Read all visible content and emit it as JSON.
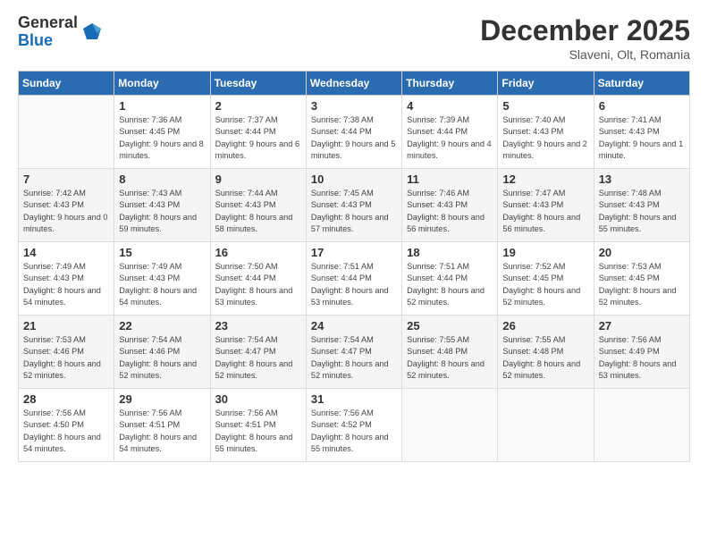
{
  "header": {
    "logo_general": "General",
    "logo_blue": "Blue",
    "month_title": "December 2025",
    "location": "Slaveni, Olt, Romania"
  },
  "weekdays": [
    "Sunday",
    "Monday",
    "Tuesday",
    "Wednesday",
    "Thursday",
    "Friday",
    "Saturday"
  ],
  "weeks": [
    [
      {
        "day": "",
        "sunrise": "",
        "sunset": "",
        "daylight": ""
      },
      {
        "day": "1",
        "sunrise": "7:36 AM",
        "sunset": "4:45 PM",
        "daylight": "9 hours and 8 minutes."
      },
      {
        "day": "2",
        "sunrise": "7:37 AM",
        "sunset": "4:44 PM",
        "daylight": "9 hours and 6 minutes."
      },
      {
        "day": "3",
        "sunrise": "7:38 AM",
        "sunset": "4:44 PM",
        "daylight": "9 hours and 5 minutes."
      },
      {
        "day": "4",
        "sunrise": "7:39 AM",
        "sunset": "4:44 PM",
        "daylight": "9 hours and 4 minutes."
      },
      {
        "day": "5",
        "sunrise": "7:40 AM",
        "sunset": "4:43 PM",
        "daylight": "9 hours and 2 minutes."
      },
      {
        "day": "6",
        "sunrise": "7:41 AM",
        "sunset": "4:43 PM",
        "daylight": "9 hours and 1 minute."
      }
    ],
    [
      {
        "day": "7",
        "sunrise": "7:42 AM",
        "sunset": "4:43 PM",
        "daylight": "9 hours and 0 minutes."
      },
      {
        "day": "8",
        "sunrise": "7:43 AM",
        "sunset": "4:43 PM",
        "daylight": "8 hours and 59 minutes."
      },
      {
        "day": "9",
        "sunrise": "7:44 AM",
        "sunset": "4:43 PM",
        "daylight": "8 hours and 58 minutes."
      },
      {
        "day": "10",
        "sunrise": "7:45 AM",
        "sunset": "4:43 PM",
        "daylight": "8 hours and 57 minutes."
      },
      {
        "day": "11",
        "sunrise": "7:46 AM",
        "sunset": "4:43 PM",
        "daylight": "8 hours and 56 minutes."
      },
      {
        "day": "12",
        "sunrise": "7:47 AM",
        "sunset": "4:43 PM",
        "daylight": "8 hours and 56 minutes."
      },
      {
        "day": "13",
        "sunrise": "7:48 AM",
        "sunset": "4:43 PM",
        "daylight": "8 hours and 55 minutes."
      }
    ],
    [
      {
        "day": "14",
        "sunrise": "7:49 AM",
        "sunset": "4:43 PM",
        "daylight": "8 hours and 54 minutes."
      },
      {
        "day": "15",
        "sunrise": "7:49 AM",
        "sunset": "4:43 PM",
        "daylight": "8 hours and 54 minutes."
      },
      {
        "day": "16",
        "sunrise": "7:50 AM",
        "sunset": "4:44 PM",
        "daylight": "8 hours and 53 minutes."
      },
      {
        "day": "17",
        "sunrise": "7:51 AM",
        "sunset": "4:44 PM",
        "daylight": "8 hours and 53 minutes."
      },
      {
        "day": "18",
        "sunrise": "7:51 AM",
        "sunset": "4:44 PM",
        "daylight": "8 hours and 52 minutes."
      },
      {
        "day": "19",
        "sunrise": "7:52 AM",
        "sunset": "4:45 PM",
        "daylight": "8 hours and 52 minutes."
      },
      {
        "day": "20",
        "sunrise": "7:53 AM",
        "sunset": "4:45 PM",
        "daylight": "8 hours and 52 minutes."
      }
    ],
    [
      {
        "day": "21",
        "sunrise": "7:53 AM",
        "sunset": "4:46 PM",
        "daylight": "8 hours and 52 minutes."
      },
      {
        "day": "22",
        "sunrise": "7:54 AM",
        "sunset": "4:46 PM",
        "daylight": "8 hours and 52 minutes."
      },
      {
        "day": "23",
        "sunrise": "7:54 AM",
        "sunset": "4:47 PM",
        "daylight": "8 hours and 52 minutes."
      },
      {
        "day": "24",
        "sunrise": "7:54 AM",
        "sunset": "4:47 PM",
        "daylight": "8 hours and 52 minutes."
      },
      {
        "day": "25",
        "sunrise": "7:55 AM",
        "sunset": "4:48 PM",
        "daylight": "8 hours and 52 minutes."
      },
      {
        "day": "26",
        "sunrise": "7:55 AM",
        "sunset": "4:48 PM",
        "daylight": "8 hours and 52 minutes."
      },
      {
        "day": "27",
        "sunrise": "7:56 AM",
        "sunset": "4:49 PM",
        "daylight": "8 hours and 53 minutes."
      }
    ],
    [
      {
        "day": "28",
        "sunrise": "7:56 AM",
        "sunset": "4:50 PM",
        "daylight": "8 hours and 54 minutes."
      },
      {
        "day": "29",
        "sunrise": "7:56 AM",
        "sunset": "4:51 PM",
        "daylight": "8 hours and 54 minutes."
      },
      {
        "day": "30",
        "sunrise": "7:56 AM",
        "sunset": "4:51 PM",
        "daylight": "8 hours and 55 minutes."
      },
      {
        "day": "31",
        "sunrise": "7:56 AM",
        "sunset": "4:52 PM",
        "daylight": "8 hours and 55 minutes."
      },
      {
        "day": "",
        "sunrise": "",
        "sunset": "",
        "daylight": ""
      },
      {
        "day": "",
        "sunrise": "",
        "sunset": "",
        "daylight": ""
      },
      {
        "day": "",
        "sunrise": "",
        "sunset": "",
        "daylight": ""
      }
    ]
  ]
}
